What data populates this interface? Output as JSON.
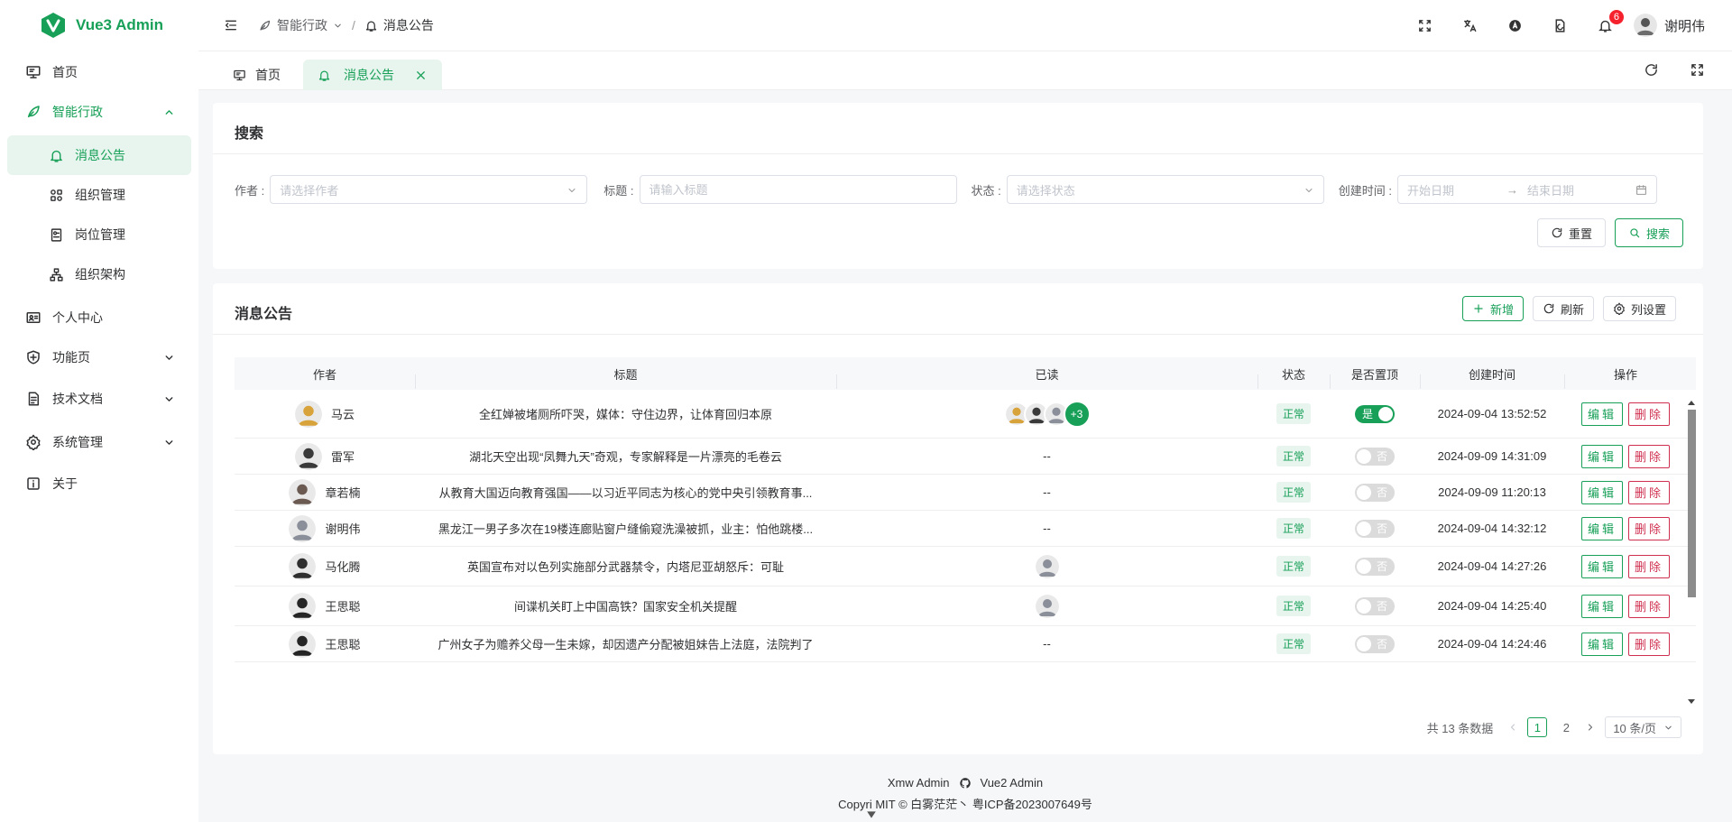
{
  "app": {
    "name": "Vue3 Admin"
  },
  "colors": {
    "brand": "#18a058",
    "danger": "#d03050",
    "badge": "#f5222d"
  },
  "sidebar": {
    "items": [
      {
        "label": "首页",
        "icon": "monitor-icon"
      },
      {
        "label": "智能行政",
        "icon": "leaf-icon",
        "open": true,
        "children": [
          {
            "label": "消息公告",
            "icon": "bell-icon",
            "active": true
          },
          {
            "label": "组织管理",
            "icon": "org-icon"
          },
          {
            "label": "岗位管理",
            "icon": "post-icon"
          },
          {
            "label": "组织架构",
            "icon": "tree-icon"
          }
        ]
      },
      {
        "label": "个人中心",
        "icon": "id-card-icon"
      },
      {
        "label": "功能页",
        "icon": "shield-icon",
        "expandable": true
      },
      {
        "label": "技术文档",
        "icon": "document-icon",
        "expandable": true
      },
      {
        "label": "系统管理",
        "icon": "gear-icon",
        "expandable": true
      },
      {
        "label": "关于",
        "icon": "info-icon"
      }
    ]
  },
  "header": {
    "breadcrumb": [
      {
        "label": "智能行政",
        "icon": "leaf-icon"
      },
      {
        "label": "消息公告",
        "icon": "bell-icon"
      }
    ],
    "notification_count": "6",
    "user_name": "谢明伟"
  },
  "tabs": [
    {
      "label": "首页",
      "icon": "monitor-icon"
    },
    {
      "label": "消息公告",
      "icon": "bell-icon",
      "active": true
    }
  ],
  "search": {
    "title": "搜索",
    "author_label": "作者",
    "author_placeholder": "请选择作者",
    "title_label": "标题",
    "title_placeholder": "请输入标题",
    "status_label": "状态",
    "status_placeholder": "请选择状态",
    "created_label": "创建时间",
    "start_placeholder": "开始日期",
    "end_placeholder": "结束日期",
    "range_sep": "→",
    "reset_label": "重置",
    "search_label": "搜索"
  },
  "table": {
    "title": "消息公告",
    "add_label": "新增",
    "refresh_label": "刷新",
    "columns_label": "列设置",
    "headers": [
      "作者",
      "标题",
      "已读",
      "状态",
      "是否置顶",
      "创建时间",
      "操作"
    ],
    "edit_label": "编辑",
    "delete_label": "删除",
    "rows": [
      {
        "author": "马云",
        "title": "全红婵被堵厕所吓哭，媒体：守住边界，让体育回归本原",
        "read": "avatars",
        "read_more": "+3",
        "status": "正常",
        "pinned": true,
        "pinned_label": "是",
        "created": "2024-09-04 13:52:52",
        "avatar_color": "#d9a33b"
      },
      {
        "author": "雷军",
        "title": "湖北天空出现“凤舞九天”奇观，专家解释是一片漂亮的毛卷云",
        "read": "--",
        "status": "正常",
        "pinned": false,
        "pinned_label": "否",
        "created": "2024-09-09 14:31:09",
        "avatar_color": "#3a3a3a"
      },
      {
        "author": "章若楠",
        "title": "从教育大国迈向教育强国——以习近平同志为核心的党中央引领教育事...",
        "read": "--",
        "status": "正常",
        "pinned": false,
        "pinned_label": "否",
        "created": "2024-09-09 11:20:13",
        "avatar_color": "#6b5a52"
      },
      {
        "author": "谢明伟",
        "title": "黑龙江一男子多次在19楼连廊贴窗户缝偷窥洗澡被抓，业主：怕他跳楼...",
        "read": "--",
        "status": "正常",
        "pinned": false,
        "pinned_label": "否",
        "created": "2024-09-04 14:32:12",
        "avatar_color": "#8a8f99"
      },
      {
        "author": "马化腾",
        "title": "英国宣布对以色列实施部分武器禁令，内塔尼亚胡怒斥：可耻",
        "read": "avatar",
        "status": "正常",
        "pinned": false,
        "pinned_label": "否",
        "created": "2024-09-04 14:27:26",
        "avatar_color": "#2f2f2f"
      },
      {
        "author": "王思聪",
        "title": "间谍机关盯上中国高铁？国家安全机关提醒",
        "read": "avatar",
        "status": "正常",
        "pinned": false,
        "pinned_label": "否",
        "created": "2024-09-04 14:25:40",
        "avatar_color": "#252525"
      },
      {
        "author": "王思聪",
        "title": "广州女子为赡养父母一生未嫁，却因遗产分配被姐妹告上法庭，法院判了",
        "read": "--",
        "status": "正常",
        "pinned": false,
        "pinned_label": "否",
        "created": "2024-09-04 14:24:46",
        "avatar_color": "#252525"
      }
    ]
  },
  "pagination": {
    "total_text": "共 13 条数据",
    "pages": [
      "1",
      "2"
    ],
    "current": "1",
    "page_size": "10 条/页"
  },
  "footer": {
    "link1": "Xmw Admin",
    "link2": "Vue2 Admin",
    "copyright": "Copyri   MIT ©  白雾茫茫丶    粤ICP备2023007649号"
  }
}
